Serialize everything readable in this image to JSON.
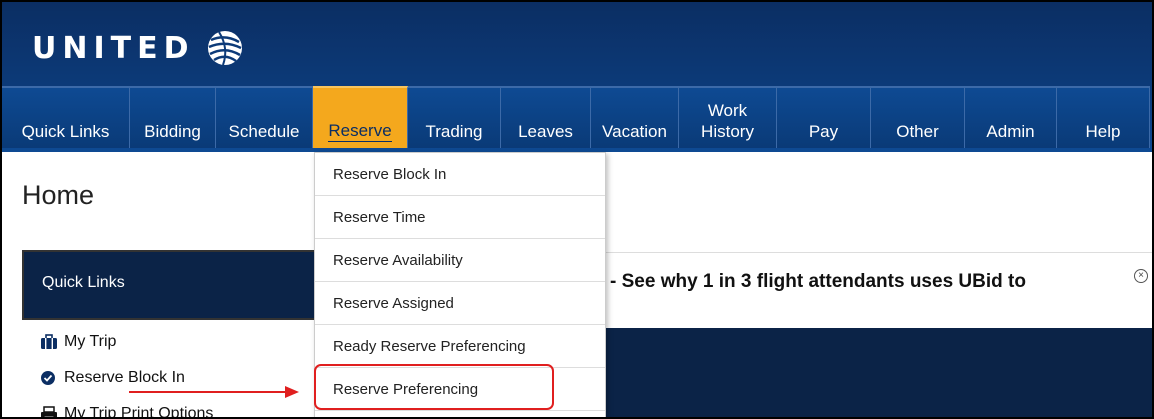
{
  "logo": {
    "text": "UNITED"
  },
  "nav": {
    "items": [
      {
        "label": "Quick Links"
      },
      {
        "label": "Bidding"
      },
      {
        "label": "Schedule"
      },
      {
        "label": "Reserve",
        "active": true
      },
      {
        "label": "Trading"
      },
      {
        "label": "Leaves"
      },
      {
        "label": "Vacation"
      },
      {
        "label": "Work History"
      },
      {
        "label": "Pay"
      },
      {
        "label": "Other"
      },
      {
        "label": "Admin"
      },
      {
        "label": "Help"
      }
    ]
  },
  "page": {
    "title": "Home"
  },
  "quick_links_panel": {
    "title": "Quick Links"
  },
  "quick_links": [
    {
      "label": "My Trip",
      "icon": "briefcase-icon"
    },
    {
      "label": "Reserve Block In",
      "icon": "check-circle-icon"
    },
    {
      "label": "My Trip Print Options",
      "icon": "printer-icon"
    }
  ],
  "reserve_menu": [
    {
      "label": "Reserve Block In"
    },
    {
      "label": "Reserve Time"
    },
    {
      "label": "Reserve Availability"
    },
    {
      "label": "Reserve Assigned"
    },
    {
      "label": "Ready Reserve Preferencing"
    },
    {
      "label": "Reserve Preferencing",
      "highlighted": true
    }
  ],
  "banner": {
    "text": "- See why 1 in 3 flight attendants uses UBid to"
  },
  "colors": {
    "header": "#0b2e63",
    "active_tab": "#f4a81d",
    "highlight": "#e01f1f",
    "panel": "#0b2347"
  }
}
